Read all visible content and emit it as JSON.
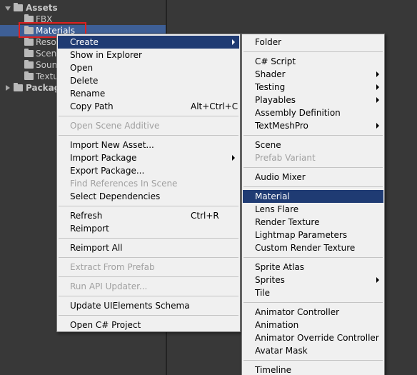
{
  "project_tree": {
    "assets_label": "Assets",
    "children": [
      {
        "label": "FBX"
      },
      {
        "label": "Materials"
      },
      {
        "label": "Reso"
      },
      {
        "label": "Scen"
      },
      {
        "label": "Soun"
      },
      {
        "label": "Textu"
      }
    ],
    "packages_label": "Packag"
  },
  "context_menu": {
    "items": [
      {
        "label": "Create"
      },
      {
        "label": "Show in Explorer"
      },
      {
        "label": "Open"
      },
      {
        "label": "Delete"
      },
      {
        "label": "Rename"
      },
      {
        "label": "Copy Path",
        "shortcut": "Alt+Ctrl+C"
      },
      {
        "label": "Open Scene Additive"
      },
      {
        "label": "Import New Asset..."
      },
      {
        "label": "Import Package"
      },
      {
        "label": "Export Package..."
      },
      {
        "label": "Find References In Scene"
      },
      {
        "label": "Select Dependencies"
      },
      {
        "label": "Refresh",
        "shortcut": "Ctrl+R"
      },
      {
        "label": "Reimport"
      },
      {
        "label": "Reimport All"
      },
      {
        "label": "Extract From Prefab"
      },
      {
        "label": "Run API Updater..."
      },
      {
        "label": "Update UIElements Schema"
      },
      {
        "label": "Open C# Project"
      }
    ]
  },
  "create_submenu": {
    "items": [
      {
        "label": "Folder"
      },
      {
        "label": "C# Script"
      },
      {
        "label": "Shader"
      },
      {
        "label": "Testing"
      },
      {
        "label": "Playables"
      },
      {
        "label": "Assembly Definition"
      },
      {
        "label": "TextMeshPro"
      },
      {
        "label": "Scene"
      },
      {
        "label": "Prefab Variant"
      },
      {
        "label": "Audio Mixer"
      },
      {
        "label": "Material"
      },
      {
        "label": "Lens Flare"
      },
      {
        "label": "Render Texture"
      },
      {
        "label": "Lightmap Parameters"
      },
      {
        "label": "Custom Render Texture"
      },
      {
        "label": "Sprite Atlas"
      },
      {
        "label": "Sprites"
      },
      {
        "label": "Tile"
      },
      {
        "label": "Animator Controller"
      },
      {
        "label": "Animation"
      },
      {
        "label": "Animator Override Controller"
      },
      {
        "label": "Avatar Mask"
      },
      {
        "label": "Timeline"
      }
    ]
  }
}
